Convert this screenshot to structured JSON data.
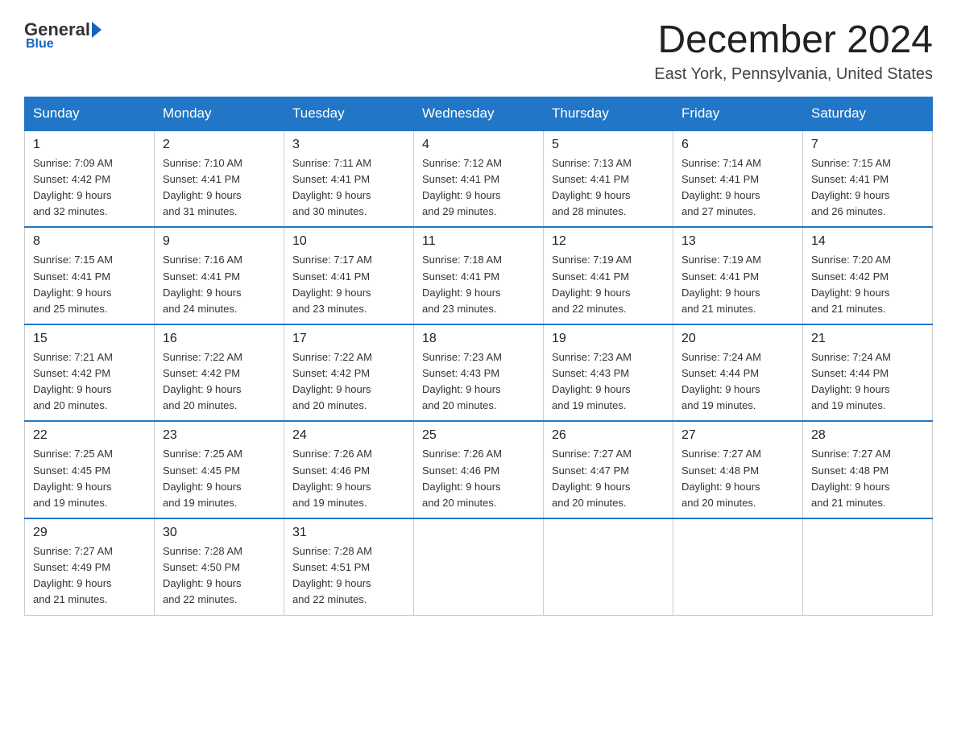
{
  "logo": {
    "general": "General",
    "blue": "Blue"
  },
  "title": "December 2024",
  "location": "East York, Pennsylvania, United States",
  "weekdays": [
    "Sunday",
    "Monday",
    "Tuesday",
    "Wednesday",
    "Thursday",
    "Friday",
    "Saturday"
  ],
  "weeks": [
    [
      {
        "day": "1",
        "sunrise": "7:09 AM",
        "sunset": "4:42 PM",
        "daylight": "9 hours and 32 minutes."
      },
      {
        "day": "2",
        "sunrise": "7:10 AM",
        "sunset": "4:41 PM",
        "daylight": "9 hours and 31 minutes."
      },
      {
        "day": "3",
        "sunrise": "7:11 AM",
        "sunset": "4:41 PM",
        "daylight": "9 hours and 30 minutes."
      },
      {
        "day": "4",
        "sunrise": "7:12 AM",
        "sunset": "4:41 PM",
        "daylight": "9 hours and 29 minutes."
      },
      {
        "day": "5",
        "sunrise": "7:13 AM",
        "sunset": "4:41 PM",
        "daylight": "9 hours and 28 minutes."
      },
      {
        "day": "6",
        "sunrise": "7:14 AM",
        "sunset": "4:41 PM",
        "daylight": "9 hours and 27 minutes."
      },
      {
        "day": "7",
        "sunrise": "7:15 AM",
        "sunset": "4:41 PM",
        "daylight": "9 hours and 26 minutes."
      }
    ],
    [
      {
        "day": "8",
        "sunrise": "7:15 AM",
        "sunset": "4:41 PM",
        "daylight": "9 hours and 25 minutes."
      },
      {
        "day": "9",
        "sunrise": "7:16 AM",
        "sunset": "4:41 PM",
        "daylight": "9 hours and 24 minutes."
      },
      {
        "day": "10",
        "sunrise": "7:17 AM",
        "sunset": "4:41 PM",
        "daylight": "9 hours and 23 minutes."
      },
      {
        "day": "11",
        "sunrise": "7:18 AM",
        "sunset": "4:41 PM",
        "daylight": "9 hours and 23 minutes."
      },
      {
        "day": "12",
        "sunrise": "7:19 AM",
        "sunset": "4:41 PM",
        "daylight": "9 hours and 22 minutes."
      },
      {
        "day": "13",
        "sunrise": "7:19 AM",
        "sunset": "4:41 PM",
        "daylight": "9 hours and 21 minutes."
      },
      {
        "day": "14",
        "sunrise": "7:20 AM",
        "sunset": "4:42 PM",
        "daylight": "9 hours and 21 minutes."
      }
    ],
    [
      {
        "day": "15",
        "sunrise": "7:21 AM",
        "sunset": "4:42 PM",
        "daylight": "9 hours and 20 minutes."
      },
      {
        "day": "16",
        "sunrise": "7:22 AM",
        "sunset": "4:42 PM",
        "daylight": "9 hours and 20 minutes."
      },
      {
        "day": "17",
        "sunrise": "7:22 AM",
        "sunset": "4:42 PM",
        "daylight": "9 hours and 20 minutes."
      },
      {
        "day": "18",
        "sunrise": "7:23 AM",
        "sunset": "4:43 PM",
        "daylight": "9 hours and 20 minutes."
      },
      {
        "day": "19",
        "sunrise": "7:23 AM",
        "sunset": "4:43 PM",
        "daylight": "9 hours and 19 minutes."
      },
      {
        "day": "20",
        "sunrise": "7:24 AM",
        "sunset": "4:44 PM",
        "daylight": "9 hours and 19 minutes."
      },
      {
        "day": "21",
        "sunrise": "7:24 AM",
        "sunset": "4:44 PM",
        "daylight": "9 hours and 19 minutes."
      }
    ],
    [
      {
        "day": "22",
        "sunrise": "7:25 AM",
        "sunset": "4:45 PM",
        "daylight": "9 hours and 19 minutes."
      },
      {
        "day": "23",
        "sunrise": "7:25 AM",
        "sunset": "4:45 PM",
        "daylight": "9 hours and 19 minutes."
      },
      {
        "day": "24",
        "sunrise": "7:26 AM",
        "sunset": "4:46 PM",
        "daylight": "9 hours and 19 minutes."
      },
      {
        "day": "25",
        "sunrise": "7:26 AM",
        "sunset": "4:46 PM",
        "daylight": "9 hours and 20 minutes."
      },
      {
        "day": "26",
        "sunrise": "7:27 AM",
        "sunset": "4:47 PM",
        "daylight": "9 hours and 20 minutes."
      },
      {
        "day": "27",
        "sunrise": "7:27 AM",
        "sunset": "4:48 PM",
        "daylight": "9 hours and 20 minutes."
      },
      {
        "day": "28",
        "sunrise": "7:27 AM",
        "sunset": "4:48 PM",
        "daylight": "9 hours and 21 minutes."
      }
    ],
    [
      {
        "day": "29",
        "sunrise": "7:27 AM",
        "sunset": "4:49 PM",
        "daylight": "9 hours and 21 minutes."
      },
      {
        "day": "30",
        "sunrise": "7:28 AM",
        "sunset": "4:50 PM",
        "daylight": "9 hours and 22 minutes."
      },
      {
        "day": "31",
        "sunrise": "7:28 AM",
        "sunset": "4:51 PM",
        "daylight": "9 hours and 22 minutes."
      },
      null,
      null,
      null,
      null
    ]
  ]
}
